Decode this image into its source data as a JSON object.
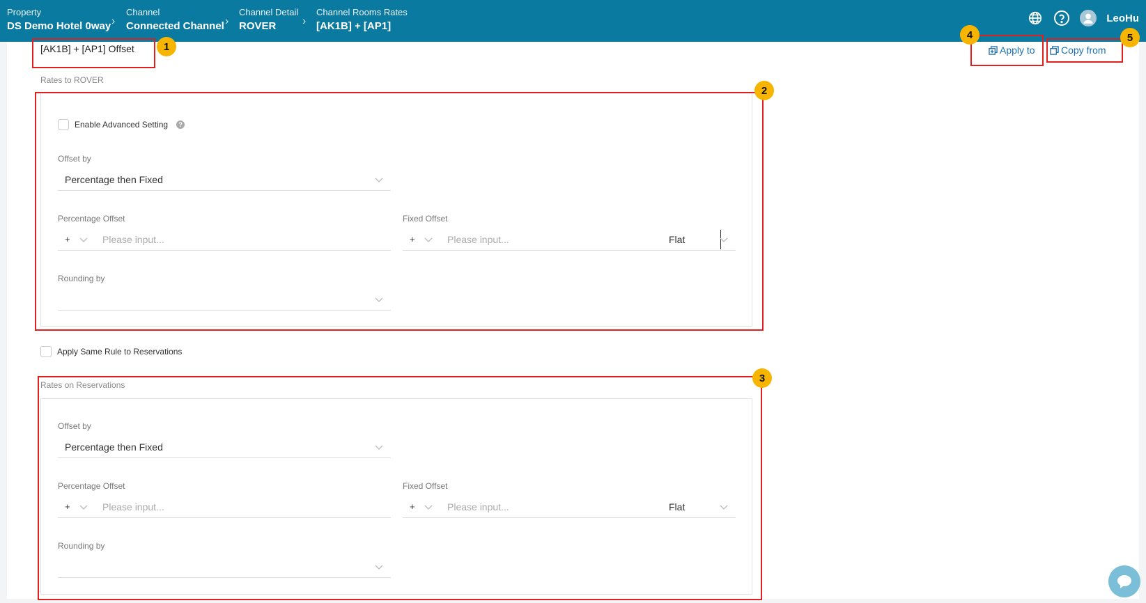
{
  "breadcrumb": [
    {
      "label": "Property",
      "value": "DS Demo Hotel 0way"
    },
    {
      "label": "Channel",
      "value": "Connected Channel"
    },
    {
      "label": "Channel Detail",
      "value": "ROVER"
    },
    {
      "label": "Channel Rooms Rates",
      "value": "[AK1B] + [AP1]"
    }
  ],
  "user": {
    "name": "LeoHu"
  },
  "page": {
    "title": "[AK1B] + [AP1] Offset"
  },
  "actions": {
    "apply_to": "Apply to",
    "copy_from": "Copy from"
  },
  "rates_to": {
    "section_label": "Rates to ROVER",
    "advanced_label": "Enable Advanced Setting",
    "offset_by_label": "Offset by",
    "offset_by_value": "Percentage then Fixed",
    "percentage_label": "Percentage Offset",
    "percentage_sign": "+",
    "percentage_placeholder": "Please input...",
    "fixed_label": "Fixed Offset",
    "fixed_sign": "+",
    "fixed_placeholder": "Please input...",
    "fixed_unit": "Flat",
    "rounding_label": "Rounding by",
    "rounding_value": ""
  },
  "apply_same_label": "Apply Same Rule to Reservations",
  "rates_on": {
    "section_label": "Rates on Reservations",
    "offset_by_label": "Offset by",
    "offset_by_value": "Percentage then Fixed",
    "percentage_label": "Percentage Offset",
    "percentage_sign": "+",
    "percentage_placeholder": "Please input...",
    "fixed_label": "Fixed Offset",
    "fixed_sign": "+",
    "fixed_placeholder": "Please input...",
    "fixed_unit": "Flat",
    "rounding_label": "Rounding by",
    "rounding_value": ""
  },
  "annotations": [
    "1",
    "2",
    "3",
    "4",
    "5"
  ],
  "colors": {
    "header": "#0a7aa1",
    "accent": "#1a6fb0",
    "highlight": "#e0201e",
    "badge": "#f7b500"
  }
}
